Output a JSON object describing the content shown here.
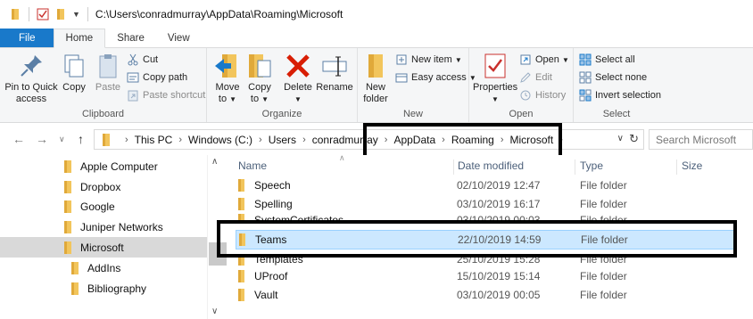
{
  "window": {
    "path_title": "C:\\Users\\conradmurray\\AppData\\Roaming\\Microsoft"
  },
  "tabs": [
    "File",
    "Home",
    "Share",
    "View"
  ],
  "ribbon": {
    "clipboard": {
      "label": "Clipboard",
      "pin": "Pin to Quick access",
      "copy": "Copy",
      "paste": "Paste",
      "cut": "Cut",
      "copy_path": "Copy path",
      "paste_shortcut": "Paste shortcut"
    },
    "organize": {
      "label": "Organize",
      "move_to": "Move to",
      "copy_to": "Copy to",
      "delete": "Delete",
      "rename": "Rename"
    },
    "new": {
      "label": "New",
      "new_folder": "New folder",
      "new_item": "New item",
      "easy_access": "Easy access"
    },
    "open": {
      "label": "Open",
      "properties": "Properties",
      "open": "Open",
      "edit": "Edit",
      "history": "History"
    },
    "select": {
      "label": "Select",
      "select_all": "Select all",
      "select_none": "Select none",
      "invert_selection": "Invert selection"
    }
  },
  "address": {
    "crumbs": [
      "This PC",
      "Windows (C:)",
      "Users",
      "conradmurray",
      "AppData",
      "Roaming",
      "Microsoft"
    ],
    "search_placeholder": "Search Microsoft"
  },
  "nav_pane": {
    "items": [
      {
        "label": "Apple Computer",
        "selected": false
      },
      {
        "label": "Dropbox",
        "selected": false
      },
      {
        "label": "Google",
        "selected": false
      },
      {
        "label": "Juniper Networks",
        "selected": false
      },
      {
        "label": "Microsoft",
        "selected": true
      },
      {
        "label": "AddIns",
        "selected": false
      },
      {
        "label": "Bibliography",
        "selected": false
      }
    ]
  },
  "file_list": {
    "columns": [
      "Name",
      "Date modified",
      "Type",
      "Size"
    ],
    "rows": [
      {
        "name": "Speech",
        "date": "02/10/2019 12:47",
        "type": "File folder"
      },
      {
        "name": "Spelling",
        "date": "03/10/2019 16:17",
        "type": "File folder"
      },
      {
        "name": "SystemCertificates",
        "date": "03/10/2019 00:03",
        "type": "File folder"
      },
      {
        "name": "Teams",
        "date": "22/10/2019 14:59",
        "type": "File folder"
      },
      {
        "name": "Templates",
        "date": "25/10/2019 15:28",
        "type": "File folder"
      },
      {
        "name": "UProof",
        "date": "15/10/2019 15:14",
        "type": "File folder"
      },
      {
        "name": "Vault",
        "date": "03/10/2019 00:05",
        "type": "File folder"
      }
    ]
  },
  "colors": {
    "file_tab": "#1979ca",
    "selected_row": "#cce8ff",
    "folder": "#f2c55c",
    "highlight_border": "#000000"
  }
}
